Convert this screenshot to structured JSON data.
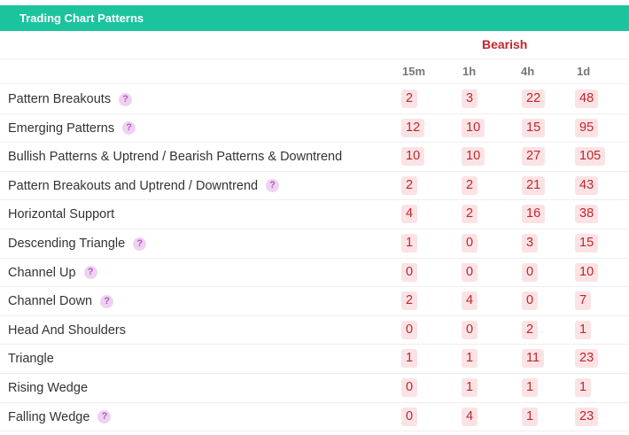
{
  "header": {
    "title": "Trading Chart Patterns"
  },
  "group_label": "Bearish",
  "columns": [
    "15m",
    "1h",
    "4h",
    "1d"
  ],
  "rows": [
    {
      "label": "Pattern Breakouts",
      "help": true,
      "values": [
        "2",
        "3",
        "22",
        "48"
      ]
    },
    {
      "label": "Emerging Patterns",
      "help": true,
      "values": [
        "12",
        "10",
        "15",
        "95"
      ]
    },
    {
      "label": "Bullish Patterns & Uptrend / Bearish Patterns & Downtrend",
      "help": false,
      "values": [
        "10",
        "10",
        "27",
        "105"
      ]
    },
    {
      "label": "Pattern Breakouts and Uptrend / Downtrend",
      "help": true,
      "values": [
        "2",
        "2",
        "21",
        "43"
      ]
    },
    {
      "label": "Horizontal Support",
      "help": false,
      "values": [
        "4",
        "2",
        "16",
        "38"
      ]
    },
    {
      "label": "Descending Triangle",
      "help": true,
      "values": [
        "1",
        "0",
        "3",
        "15"
      ]
    },
    {
      "label": "Channel Up",
      "help": true,
      "values": [
        "0",
        "0",
        "0",
        "10"
      ]
    },
    {
      "label": "Channel Down",
      "help": true,
      "values": [
        "2",
        "4",
        "0",
        "7"
      ]
    },
    {
      "label": "Head And Shoulders",
      "help": false,
      "values": [
        "0",
        "0",
        "2",
        "1"
      ]
    },
    {
      "label": "Triangle",
      "help": false,
      "values": [
        "1",
        "1",
        "11",
        "23"
      ]
    },
    {
      "label": "Rising Wedge",
      "help": false,
      "values": [
        "0",
        "1",
        "1",
        "1"
      ]
    },
    {
      "label": "Falling Wedge",
      "help": true,
      "values": [
        "0",
        "4",
        "1",
        "23"
      ]
    }
  ],
  "help_glyph": "?",
  "colors": {
    "header_bg": "#1cc49e",
    "bearish": "#c0262b",
    "badge_bg": "#fbe3e5",
    "help_bg": "#efd2f2"
  },
  "icons": {
    "help": "question-circle-icon"
  }
}
